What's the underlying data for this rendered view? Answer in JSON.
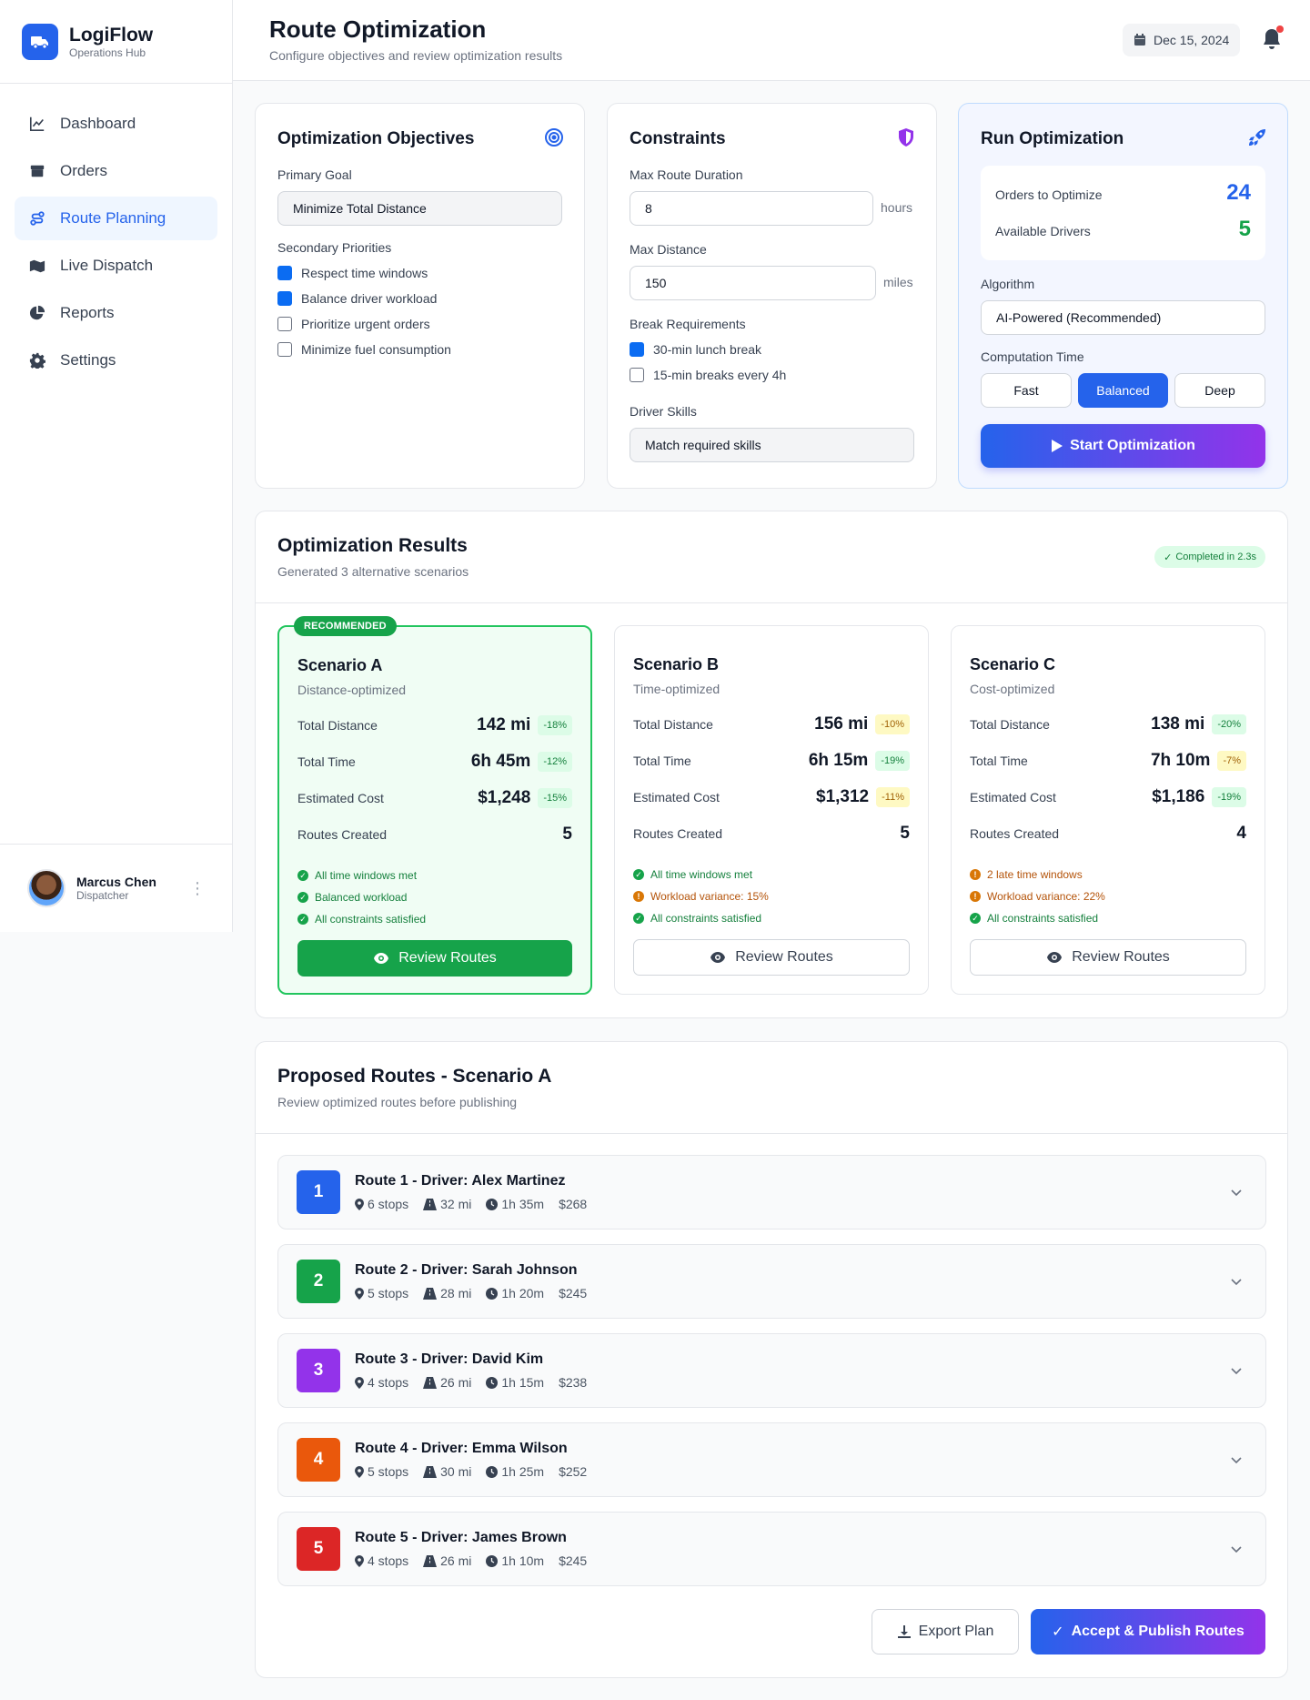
{
  "brand": {
    "name": "LogiFlow",
    "subtitle": "Operations Hub"
  },
  "nav": [
    {
      "label": "Dashboard",
      "icon": "line-chart-icon"
    },
    {
      "label": "Orders",
      "icon": "box-icon"
    },
    {
      "label": "Route Planning",
      "icon": "route-icon",
      "active": true
    },
    {
      "label": "Live Dispatch",
      "icon": "map-icon"
    },
    {
      "label": "Reports",
      "icon": "pie-chart-icon"
    },
    {
      "label": "Settings",
      "icon": "gear-icon"
    }
  ],
  "user": {
    "name": "Marcus Chen",
    "role": "Dispatcher"
  },
  "header": {
    "title": "Route Optimization",
    "subtitle": "Configure objectives and review optimization results",
    "date": "Dec 15, 2024"
  },
  "objectives": {
    "title": "Optimization Objectives",
    "primary_label": "Primary Goal",
    "primary_value": "Minimize Total Distance",
    "secondary_label": "Secondary Priorities",
    "priorities": [
      {
        "label": "Respect time windows",
        "checked": true
      },
      {
        "label": "Balance driver workload",
        "checked": true
      },
      {
        "label": "Prioritize urgent orders",
        "checked": false
      },
      {
        "label": "Minimize fuel consumption",
        "checked": false
      }
    ]
  },
  "constraints": {
    "title": "Constraints",
    "duration_label": "Max Route Duration",
    "duration_value": "8",
    "duration_unit": "hours",
    "distance_label": "Max Distance",
    "distance_value": "150",
    "distance_unit": "miles",
    "break_label": "Break Requirements",
    "breaks": [
      {
        "label": "30-min lunch break",
        "checked": true
      },
      {
        "label": "15-min breaks every 4h",
        "checked": false
      }
    ],
    "skills_label": "Driver Skills",
    "skills_value": "Match required skills"
  },
  "run": {
    "title": "Run Optimization",
    "orders_label": "Orders to Optimize",
    "orders_value": "24",
    "drivers_label": "Available Drivers",
    "drivers_value": "5",
    "algorithm_label": "Algorithm",
    "algorithm_value": "AI-Powered (Recommended)",
    "time_label": "Computation Time",
    "time_options": [
      "Fast",
      "Balanced",
      "Deep"
    ],
    "time_selected": "Balanced",
    "start_label": "Start Optimization"
  },
  "results": {
    "title": "Optimization Results",
    "subtitle": "Generated 3 alternative scenarios",
    "status": "Completed in 2.3s",
    "recommended_tag": "RECOMMENDED",
    "metric_labels": [
      "Total Distance",
      "Total Time",
      "Estimated Cost",
      "Routes Created"
    ],
    "review_label": "Review Routes",
    "scenarios": [
      {
        "name": "Scenario A",
        "type": "Distance-optimized",
        "values": [
          "142 mi",
          "6h 45m",
          "$1,248",
          "5"
        ],
        "pcts": [
          "-18%",
          "-12%",
          "-15%"
        ],
        "pct_tones": [
          "green",
          "green",
          "green"
        ],
        "notes": [
          {
            "text": "All time windows met",
            "tone": "ok"
          },
          {
            "text": "Balanced workload",
            "tone": "ok"
          },
          {
            "text": "All constraints satisfied",
            "tone": "ok"
          }
        ]
      },
      {
        "name": "Scenario B",
        "type": "Time-optimized",
        "values": [
          "156 mi",
          "6h 15m",
          "$1,312",
          "5"
        ],
        "pcts": [
          "-10%",
          "-19%",
          "-11%"
        ],
        "pct_tones": [
          "yellow",
          "green",
          "yellow"
        ],
        "notes": [
          {
            "text": "All time windows met",
            "tone": "ok"
          },
          {
            "text": "Workload variance: 15%",
            "tone": "warn"
          },
          {
            "text": "All constraints satisfied",
            "tone": "ok"
          }
        ]
      },
      {
        "name": "Scenario C",
        "type": "Cost-optimized",
        "values": [
          "138 mi",
          "7h 10m",
          "$1,186",
          "4"
        ],
        "pcts": [
          "-20%",
          "-7%",
          "-19%"
        ],
        "pct_tones": [
          "green",
          "yellow",
          "green"
        ],
        "notes": [
          {
            "text": "2 late time windows",
            "tone": "warn"
          },
          {
            "text": "Workload variance: 22%",
            "tone": "warn"
          },
          {
            "text": "All constraints satisfied",
            "tone": "ok"
          }
        ]
      }
    ]
  },
  "proposed": {
    "title": "Proposed Routes - Scenario A",
    "subtitle": "Review optimized routes before publishing",
    "routes": [
      {
        "num": "1",
        "title": "Route 1 - Driver: Alex Martinez",
        "stops": "6 stops",
        "distance": "32 mi",
        "time": "1h 35m",
        "cost": "$268",
        "color": "#2563eb"
      },
      {
        "num": "2",
        "title": "Route 2 - Driver: Sarah Johnson",
        "stops": "5 stops",
        "distance": "28 mi",
        "time": "1h 20m",
        "cost": "$245",
        "color": "#16a34a"
      },
      {
        "num": "3",
        "title": "Route 3 - Driver: David Kim",
        "stops": "4 stops",
        "distance": "26 mi",
        "time": "1h 15m",
        "cost": "$238",
        "color": "#9333ea"
      },
      {
        "num": "4",
        "title": "Route 4 - Driver: Emma Wilson",
        "stops": "5 stops",
        "distance": "30 mi",
        "time": "1h 25m",
        "cost": "$252",
        "color": "#ea580c"
      },
      {
        "num": "5",
        "title": "Route 5 - Driver: James Brown",
        "stops": "4 stops",
        "distance": "26 mi",
        "time": "1h 10m",
        "cost": "$245",
        "color": "#dc2626"
      }
    ],
    "export_label": "Export Plan",
    "publish_label": "Accept & Publish Routes"
  }
}
